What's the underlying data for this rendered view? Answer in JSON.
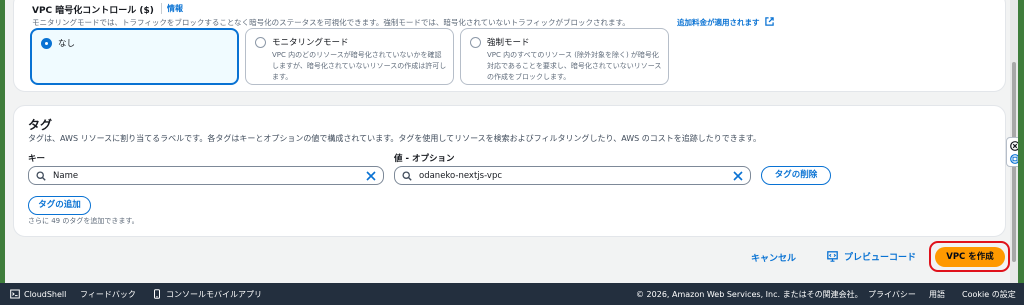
{
  "encryption": {
    "title": "VPC 暗号化コントロール ($)",
    "info_link": "情報",
    "description": "モニタリングモードでは、トラフィックをブロックすることなく暗号化のステータスを可視化できます。強制モードでは、暗号化されていないトラフィックがブロックされます。",
    "fee_link": "追加料金が適用されます",
    "options": [
      {
        "label": "なし",
        "desc": "",
        "selected": true
      },
      {
        "label": "モニタリングモード",
        "desc": "VPC 内のどのリソースが暗号化されていないかを確認しますが、暗号化されていないリソースの作成は許可します。",
        "selected": false
      },
      {
        "label": "強制モード",
        "desc": "VPC 内のすべてのリソース (除外対象を除く) が暗号化対応であることを要求し、暗号化されていないリソースの作成をブロックします。",
        "selected": false
      }
    ]
  },
  "tags": {
    "title": "タグ",
    "description": "タグは、AWS リソースに割り当てるラベルです。各タグはキーとオプションの値で構成されています。タグを使用してリソースを検索およびフィルタリングしたり、AWS のコストを追跡したりできます。",
    "key_label": "キー",
    "value_label": "値 - オプション",
    "key_value": "Name",
    "value_value": "odaneko-nextjs-vpc",
    "remove_button": "タグの削除",
    "add_button": "タグの追加",
    "remaining_note": "さらに 49 のタグを追加できます。"
  },
  "actions": {
    "cancel": "キャンセル",
    "preview": "プレビューコード",
    "create": "VPC を作成"
  },
  "footer": {
    "cloudshell": "CloudShell",
    "feedback": "フィードバック",
    "mobile_app": "コンソールモバイルアプリ",
    "copyright": "© 2026, Amazon Web Services, Inc. またはその関連会社。",
    "privacy": "プライバシー",
    "terms": "用語",
    "cookie": "Cookie の設定"
  },
  "colors": {
    "accent": "#0972d3",
    "primary_button": "#ff9900",
    "highlight": "#e0121b",
    "footer_bg": "#232f3e"
  }
}
